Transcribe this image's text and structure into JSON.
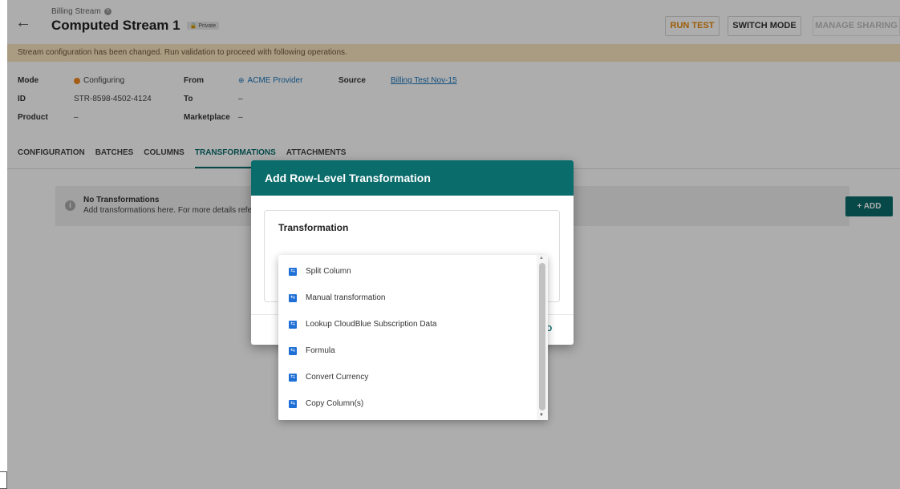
{
  "header": {
    "back_icon": "arrow-left-icon",
    "breadcrumb": "Billing Stream",
    "title": "Computed Stream 1",
    "badge": "Private",
    "buttons": {
      "run_test": "RUN TEST",
      "switch_mode": "SWITCH MODE",
      "manage_sharing": "MANAGE SHARING"
    }
  },
  "banner": "Stream configuration has been changed. Run validation to proceed with following operations.",
  "details": {
    "mode_label": "Mode",
    "mode_value": "Configuring",
    "id_label": "ID",
    "id_value": "STR-8598-4502-4124",
    "product_label": "Product",
    "product_value": "–",
    "from_label": "From",
    "from_value": "ACME Provider",
    "to_label": "To",
    "to_value": "–",
    "marketplace_label": "Marketplace",
    "marketplace_value": "–",
    "source_label": "Source",
    "source_value": "Billing Test Nov-15"
  },
  "tabs": [
    "CONFIGURATION",
    "BATCHES",
    "COLUMNS",
    "TRANSFORMATIONS",
    "ATTACHMENTS"
  ],
  "active_tab": "TRANSFORMATIONS",
  "empty_state": {
    "title": "No Transformations",
    "text": "Add transformations here. For more details refer"
  },
  "add_button": "+ ADD",
  "dialog": {
    "title": "Add Row-Level Transformation",
    "card_title": "Transformation",
    "footer_fragment": "D"
  },
  "dropdown": {
    "options": [
      "Split Column",
      "Manual transformation",
      "Lookup CloudBlue Subscription Data",
      "Formula",
      "Convert Currency",
      "Copy Column(s)"
    ]
  },
  "colors": {
    "primary": "#0b6c6c",
    "warning_banner": "#fbe5c2",
    "accent_orange": "#e8890c",
    "option_icon": "#1e6fd6"
  }
}
